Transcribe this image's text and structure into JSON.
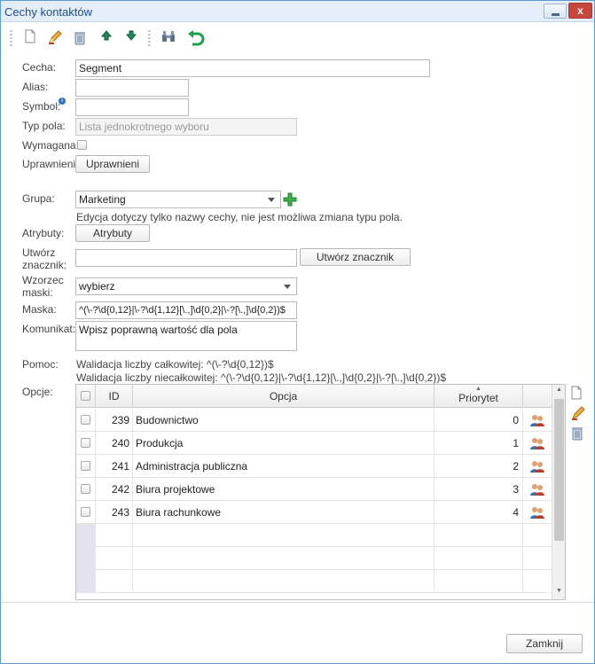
{
  "window": {
    "title": "Cechy kontaktów",
    "close_glyph": "x"
  },
  "toolbar": {
    "icons": [
      "new-page-icon",
      "edit-pencil-icon",
      "delete-trash-icon",
      "move-up-arrow-icon",
      "move-down-arrow-icon",
      "binoculars-icon",
      "undo-arrow-icon"
    ]
  },
  "form": {
    "cecha_label": "Cecha:",
    "cecha_value": "Segment",
    "alias_label": "Alias:",
    "alias_value": "",
    "symbol_label": "Symbol:",
    "symbol_value": "",
    "typ_label": "Typ pola:",
    "typ_value": "Lista jednokrotnego wyboru",
    "wymagana_label": "Wymagana:",
    "uprawnieni_label": "Uprawnieni:",
    "uprawnieni_button": "Uprawnieni",
    "grupa_label": "Grupa:",
    "grupa_value": "Marketing",
    "grupa_note": "Edycja dotyczy tylko nazwy cechy, nie jest możliwa zmiana typu pola.",
    "atrybuty_label": "Atrybuty:",
    "atrybuty_button": "Atrybuty",
    "znacznik_label_1": "Utwórz",
    "znacznik_label_2": "znacznik:",
    "znacznik_value": "",
    "znacznik_button": "Utwórz znacznik",
    "wzorzec_label_1": "Wzorzec",
    "wzorzec_label_2": "maski:",
    "wzorzec_value": "wybierz",
    "maska_label": "Maska:",
    "maska_value": "^(\\-?\\d{0,12}|\\-?\\d{1,12}[\\.,]\\d{0,2}|\\-?[\\.,]\\d{0,2})$",
    "komunikat_label": "Komunikat:",
    "komunikat_value": "Wpisz poprawną wartość dla pola",
    "pomoc_label": "Pomoc:",
    "pomoc_line1": "Walidacja liczby całkowitej: ^(\\-?\\d{0,12})$",
    "pomoc_line2": "Walidacja liczby niecałkowitej: ^(\\-?\\d{0,12}|\\-?\\d{1,12}[\\.,]\\d{0,2}|\\-?[\\.,]\\d{0,2})$",
    "opcje_label": "Opcje:"
  },
  "grid": {
    "headers": {
      "id": "ID",
      "opcja": "Opcja",
      "priorytet": "Priorytet"
    },
    "rows": [
      {
        "id": "239",
        "opcja": "Budownictwo",
        "priorytet": "0"
      },
      {
        "id": "240",
        "opcja": "Produkcja",
        "priorytet": "1"
      },
      {
        "id": "241",
        "opcja": "Administracja publiczna",
        "priorytet": "2"
      },
      {
        "id": "242",
        "opcja": "Biura projektowe",
        "priorytet": "3"
      },
      {
        "id": "243",
        "opcja": "Biura rachunkowe",
        "priorytet": "4"
      }
    ]
  },
  "footer": {
    "close_button": "Zamknij"
  }
}
